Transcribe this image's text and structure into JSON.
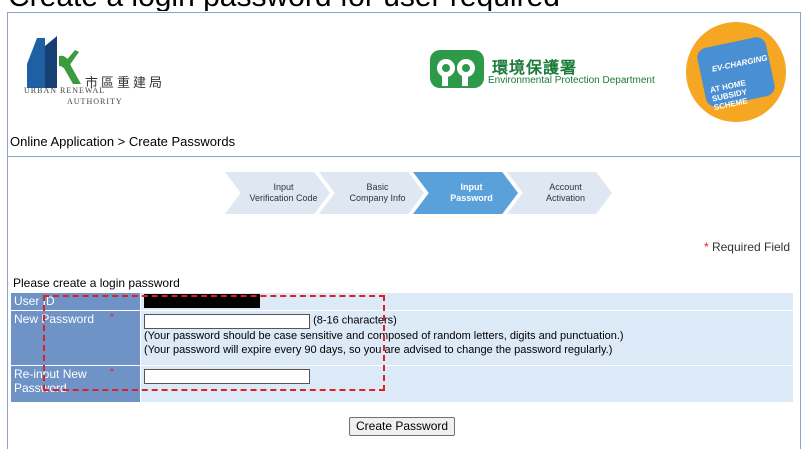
{
  "header_partial": "Create a login password for user required",
  "ura": {
    "chinese": "市區重建局",
    "english_line1": "URBAN RENEWAL",
    "english_line2": "AUTHORITY"
  },
  "epd": {
    "chinese": "環境保護署",
    "english": "Environmental Protection Department"
  },
  "ev_badge": {
    "line1": "EV-CHARGING",
    "line2": "AT HOME SUBSIDY SCHEME"
  },
  "breadcrumb": "Online Application > Create Passwords",
  "steps": [
    {
      "line1": "Input",
      "line2": "Verification Code",
      "active": false
    },
    {
      "line1": "Basic",
      "line2": "Company Info",
      "active": false
    },
    {
      "line1": "Input",
      "line2": "Password",
      "active": true
    },
    {
      "line1": "Account",
      "line2": "Activation",
      "active": false
    }
  ],
  "required_marker": "*",
  "required_label": " Required Field",
  "form": {
    "caption": "Please create a login password",
    "user_id_label": "User ID",
    "new_password_label": "New Password",
    "new_password_length": "(8-16 characters)",
    "new_password_hint1": "(Your password should be case sensitive and composed of random letters, digits and punctuation.)",
    "new_password_hint2": "(Your password will expire every 90 days, so you are advised to change the password regularly.)",
    "reinput_label_line1": "Re-input New",
    "reinput_label_line2": "Password",
    "star": "*"
  },
  "create_button": "Create Password",
  "colors": {
    "label_bg": "#6f93c6",
    "value_bg": "#dce9f7",
    "active_step": "#5aa1dc",
    "inactive_step": "#dfe8f2",
    "annotation": "#e02020"
  }
}
